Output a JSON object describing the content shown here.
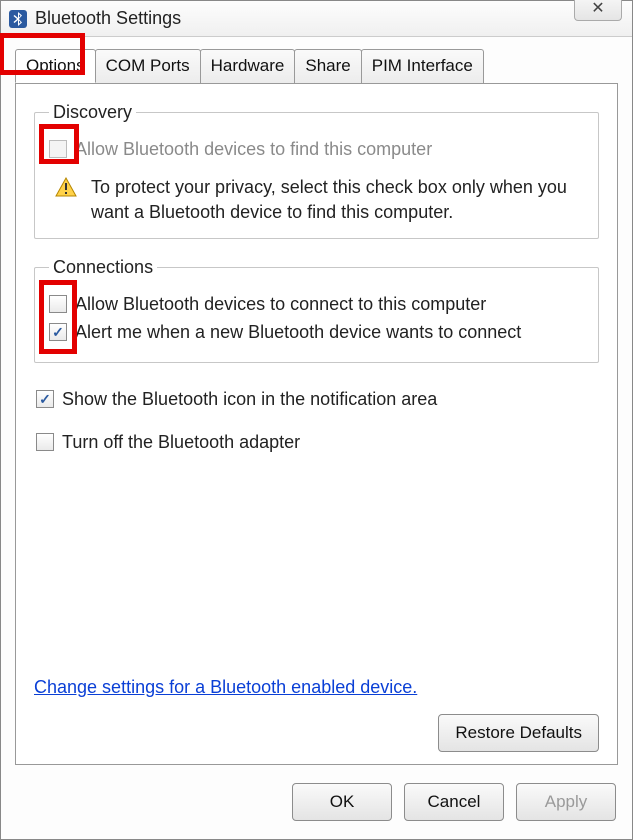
{
  "window": {
    "title": "Bluetooth Settings"
  },
  "tabs": [
    {
      "label": "Options",
      "active": true
    },
    {
      "label": "COM Ports",
      "active": false
    },
    {
      "label": "Hardware",
      "active": false
    },
    {
      "label": "Share",
      "active": false
    },
    {
      "label": "PIM Interface",
      "active": false
    }
  ],
  "discovery": {
    "legend": "Discovery",
    "allow_find": {
      "label": "Allow Bluetooth devices to find this computer",
      "checked": false,
      "disabled": true
    },
    "warning": "To protect your privacy, select this check box only when you want a Bluetooth device to find this computer."
  },
  "connections": {
    "legend": "Connections",
    "allow_connect": {
      "label": "Allow Bluetooth devices to connect to this computer",
      "checked": false
    },
    "alert_new": {
      "label": "Alert me when a new Bluetooth device wants to connect",
      "checked": true
    }
  },
  "extras": {
    "show_icon": {
      "label": "Show the Bluetooth icon in the notification area",
      "checked": true
    },
    "turn_off": {
      "label": "Turn off the Bluetooth adapter",
      "checked": false
    }
  },
  "link_text": "Change settings for a Bluetooth enabled device.",
  "buttons": {
    "restore": "Restore Defaults",
    "ok": "OK",
    "cancel": "Cancel",
    "apply": "Apply"
  }
}
